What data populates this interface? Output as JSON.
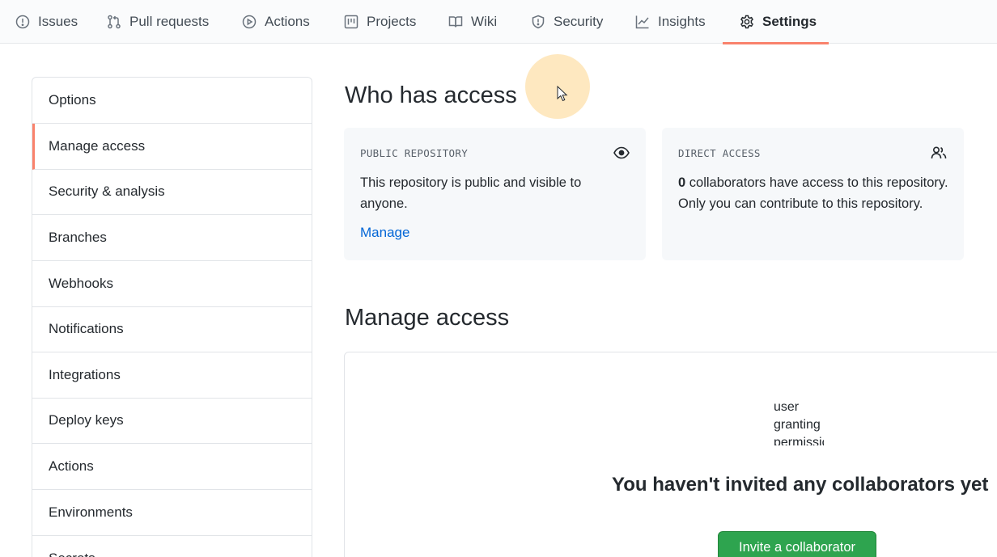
{
  "nav": {
    "tabs": [
      {
        "label": "Issues",
        "icon": "issue-icon"
      },
      {
        "label": "Pull requests",
        "icon": "pull-request-icon"
      },
      {
        "label": "Actions",
        "icon": "play-icon"
      },
      {
        "label": "Projects",
        "icon": "project-icon"
      },
      {
        "label": "Wiki",
        "icon": "book-icon"
      },
      {
        "label": "Security",
        "icon": "shield-icon"
      },
      {
        "label": "Insights",
        "icon": "graph-icon"
      },
      {
        "label": "Settings",
        "icon": "gear-icon",
        "active": true
      }
    ],
    "active_color": "#f9826c"
  },
  "sidebar": {
    "items": [
      {
        "label": "Options"
      },
      {
        "label": "Manage access",
        "selected": true
      },
      {
        "label": "Security & analysis"
      },
      {
        "label": "Branches"
      },
      {
        "label": "Webhooks"
      },
      {
        "label": "Notifications"
      },
      {
        "label": "Integrations"
      },
      {
        "label": "Deploy keys"
      },
      {
        "label": "Actions"
      },
      {
        "label": "Environments"
      },
      {
        "label": "Secrets"
      }
    ]
  },
  "who_has_access": {
    "title": "Who has access",
    "public_card": {
      "label": "PUBLIC REPOSITORY",
      "icon": "eye-icon",
      "text": "This repository is public and visible to anyone.",
      "link": "Manage"
    },
    "direct_card": {
      "label": "DIRECT ACCESS",
      "icon": "people-icon",
      "count": "0",
      "text": " collaborators have access to this repository. Only you can contribute to this repository."
    }
  },
  "manage_access": {
    "title": "Manage access",
    "image_alt": "user granting permissions",
    "empty_title": "You haven't invited any collaborators yet",
    "invite_button": "Invite a collaborator"
  },
  "colors": {
    "link": "#0366d6",
    "primary_button": "#2ea44f"
  }
}
